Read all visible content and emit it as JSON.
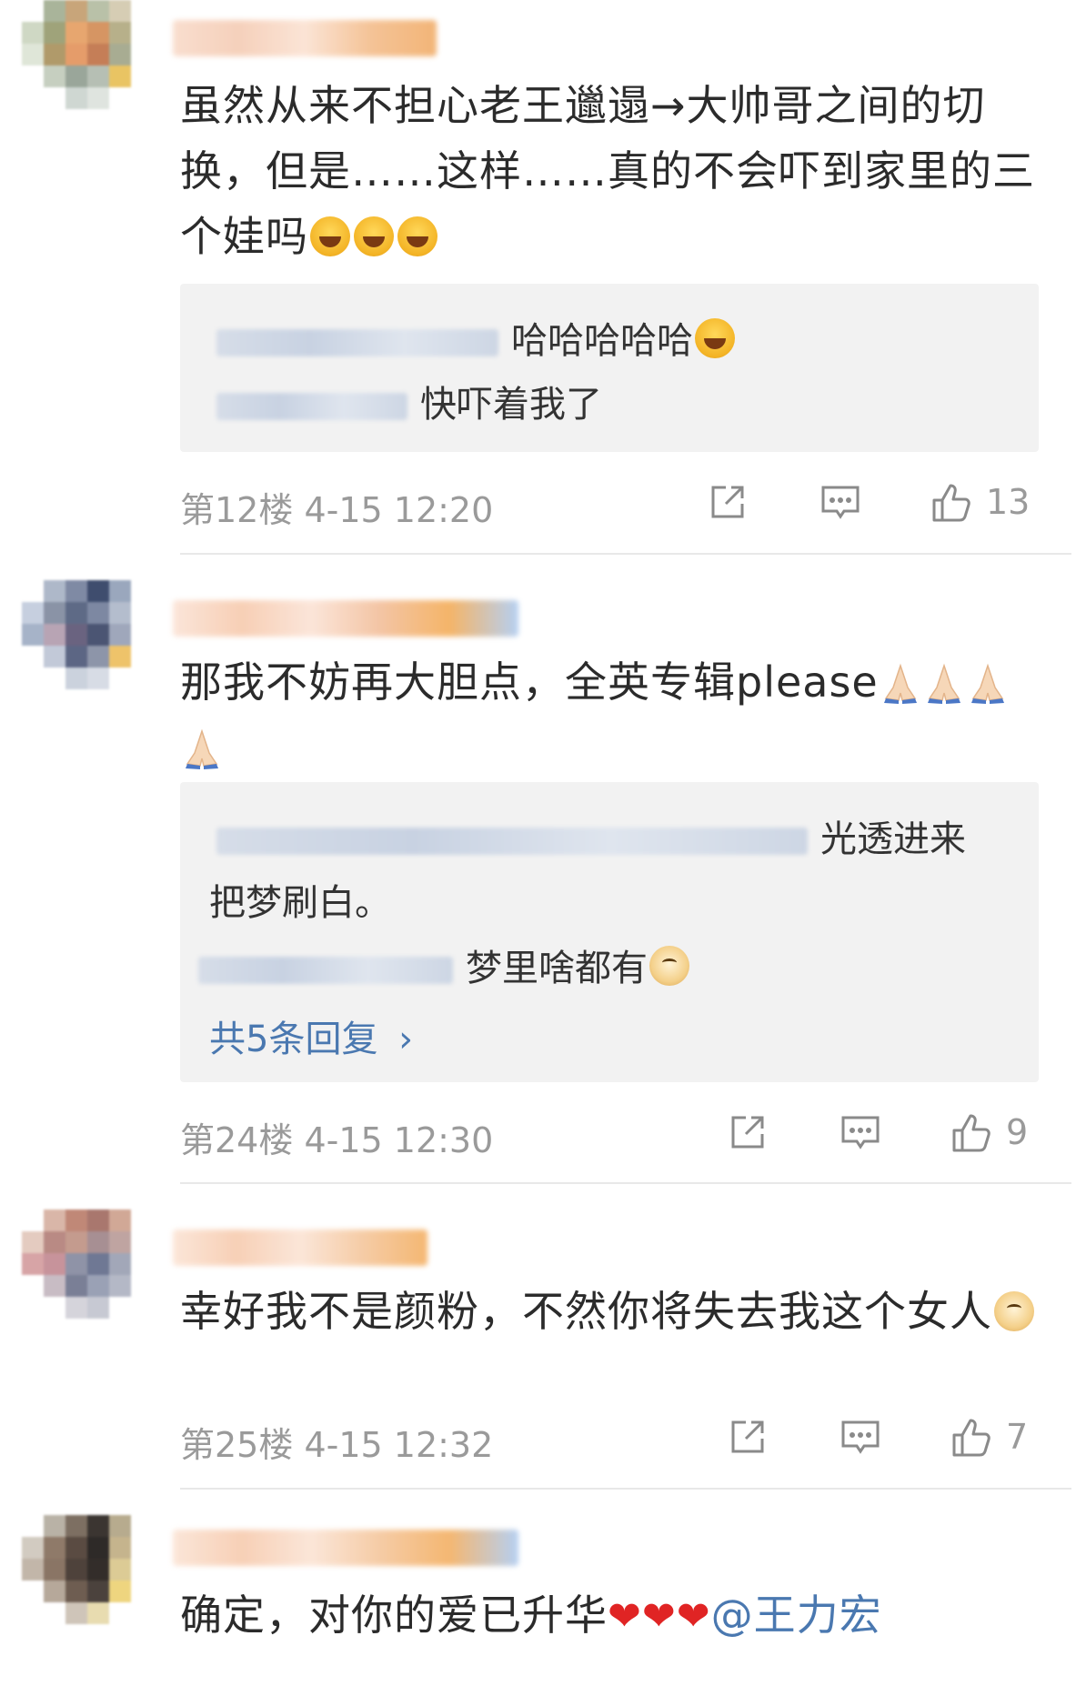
{
  "comments": [
    {
      "text": "虽然从来不担心老王邋遢→大帅哥之间的切换，但是……这样……真的不会吓到家里的三个娃吗",
      "emoji_tail": "laugh-emoji x3",
      "replies": [
        {
          "text": "哈哈哈哈哈"
        },
        {
          "text": "快吓着我了"
        }
      ],
      "floor": "第12楼",
      "time": "4-15 12:20",
      "likes": "13"
    },
    {
      "text": "那我不妨再大胆点，全英专辑please",
      "emoji_tail": "pray-emoji x4",
      "replies": [
        {
          "text": "光透进来"
        },
        {
          "text": "把梦刷白。"
        },
        {
          "text": "梦里啥都有"
        }
      ],
      "more_replies": "共5条回复",
      "floor": "第24楼",
      "time": "4-15 12:30",
      "likes": "9"
    },
    {
      "text": "幸好我不是颜粉，不然你将失去我这个女人",
      "emoji_tail": "doge-emoji",
      "floor": "第25楼",
      "time": "4-15 12:32",
      "likes": "7"
    },
    {
      "text": "确定，对你的爱已升华",
      "emoji_tail": "heart-emoji x3",
      "mention": "@王力宏"
    }
  ],
  "colors": {
    "link": "#4a78b0",
    "meta_text": "#9a9a9a",
    "reply_bg": "#f2f2f2",
    "heart": "#e02424"
  }
}
